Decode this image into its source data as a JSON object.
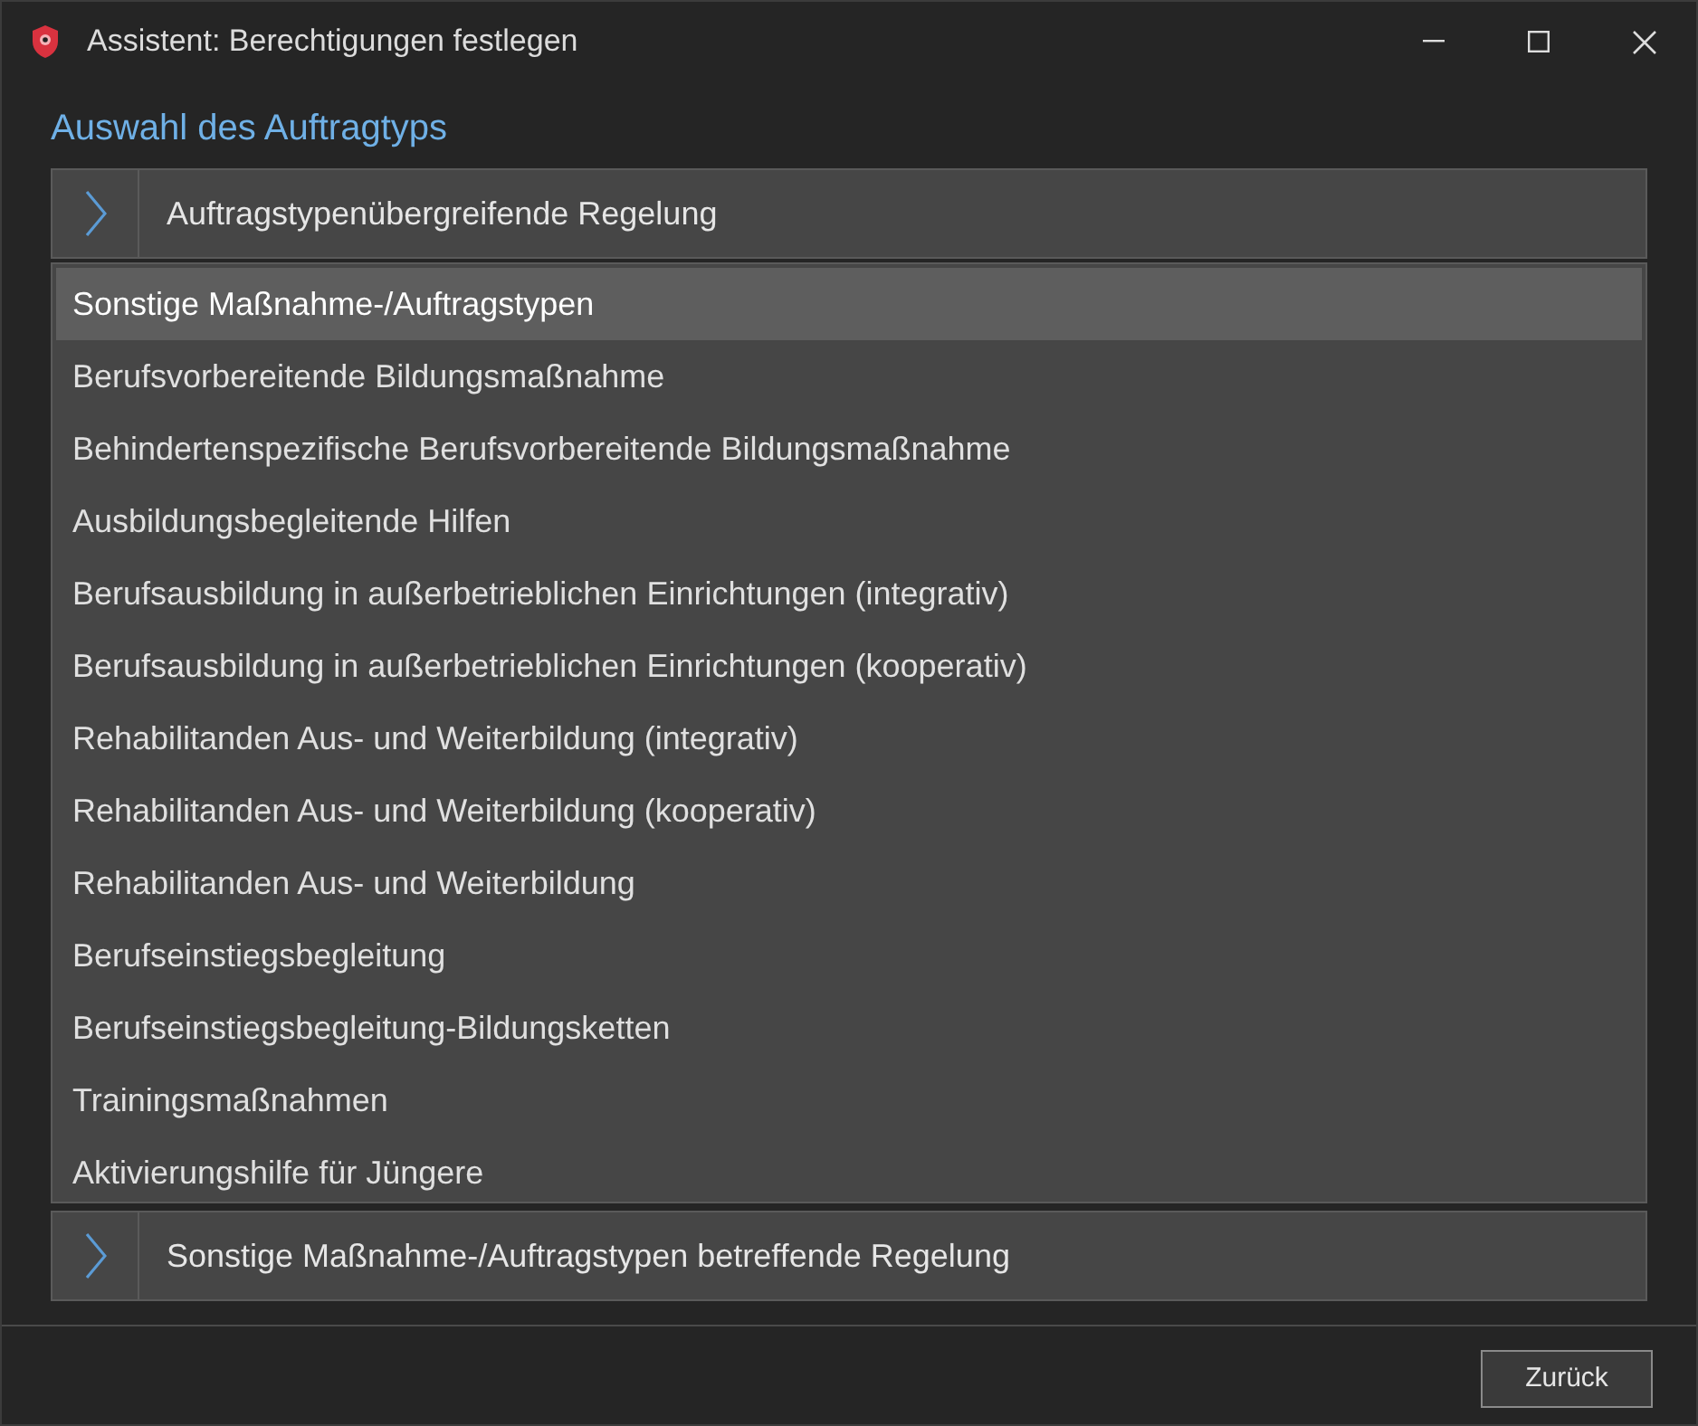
{
  "window": {
    "title": "Assistent: Berechtigungen festlegen"
  },
  "heading": "Auswahl des Auftragtyps",
  "sections": [
    {
      "label": "Auftragstypenübergreifende Regelung",
      "expanded": false
    },
    {
      "label": "Sonstige Maßnahme-/Auftragstypen betreffende Regelung",
      "expanded": false
    }
  ],
  "list": [
    {
      "label": "Sonstige Maßnahme-/Auftragstypen",
      "selected": true
    },
    {
      "label": "Berufsvorbereitende Bildungsmaßnahme",
      "selected": false
    },
    {
      "label": "Behindertenspezifische Berufsvorbereitende Bildungsmaßnahme",
      "selected": false
    },
    {
      "label": "Ausbildungsbegleitende Hilfen",
      "selected": false
    },
    {
      "label": "Berufsausbildung in außerbetrieblichen Einrichtungen (integrativ)",
      "selected": false
    },
    {
      "label": "Berufsausbildung in außerbetrieblichen Einrichtungen (kooperativ)",
      "selected": false
    },
    {
      "label": "Rehabilitanden Aus- und Weiterbildung (integrativ)",
      "selected": false
    },
    {
      "label": "Rehabilitanden Aus- und Weiterbildung (kooperativ)",
      "selected": false
    },
    {
      "label": "Rehabilitanden Aus- und Weiterbildung",
      "selected": false
    },
    {
      "label": "Berufseinstiegsbegleitung",
      "selected": false
    },
    {
      "label": "Berufseinstiegsbegleitung-Bildungsketten",
      "selected": false
    },
    {
      "label": "Trainingsmaßnahmen",
      "selected": false
    },
    {
      "label": "Aktivierungshilfe für Jüngere",
      "selected": false
    }
  ],
  "buttons": [
    "Zurück"
  ]
}
